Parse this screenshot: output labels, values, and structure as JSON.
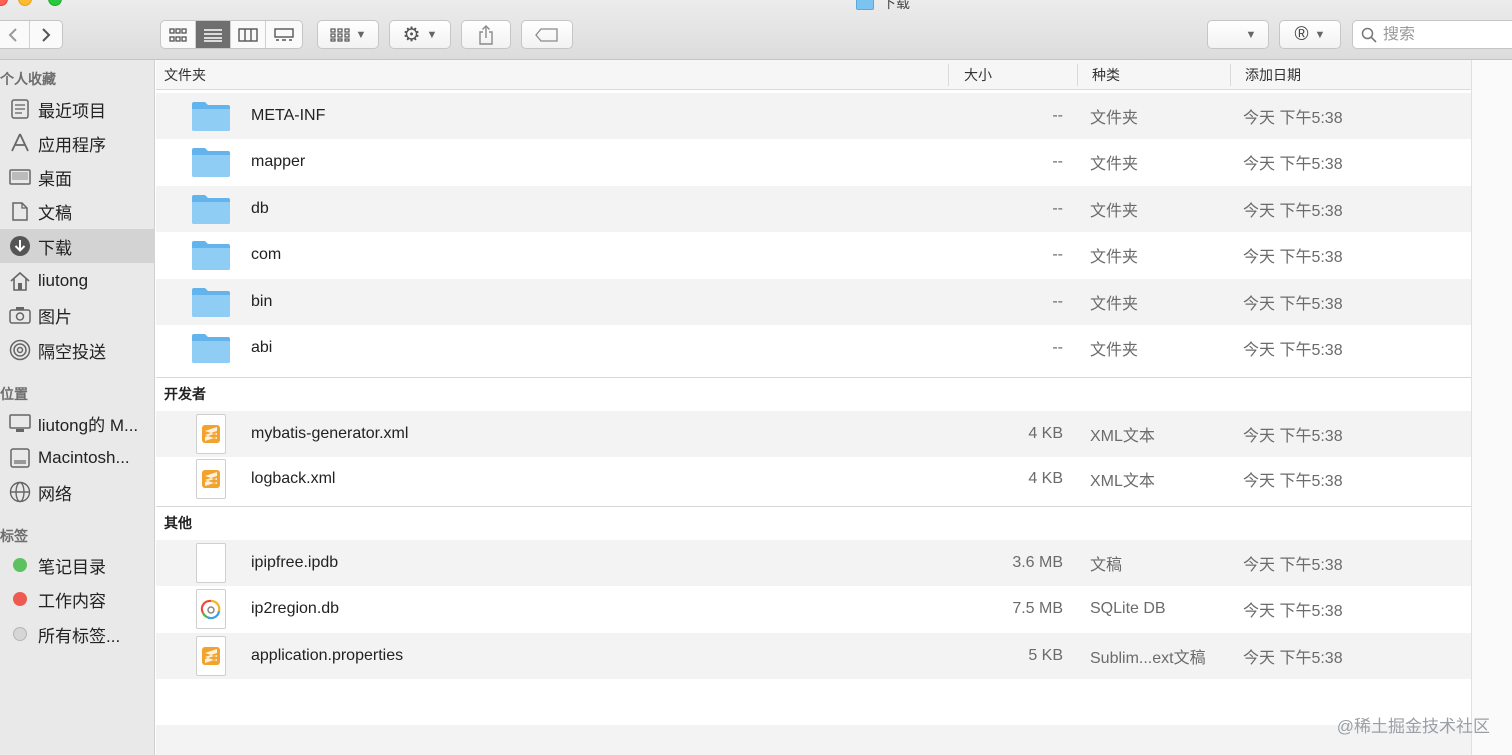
{
  "window": {
    "title": "下载"
  },
  "toolbar": {
    "search_placeholder": "搜索",
    "view_modes": [
      "icons",
      "list",
      "columns",
      "gallery"
    ],
    "active_view": "list"
  },
  "sidebar": {
    "favorites_header": "个人收藏",
    "favorites": [
      {
        "label": "最近项目",
        "icon": "recents-icon"
      },
      {
        "label": "应用程序",
        "icon": "applications-icon"
      },
      {
        "label": "桌面",
        "icon": "desktop-icon"
      },
      {
        "label": "文稿",
        "icon": "documents-icon"
      },
      {
        "label": "下载",
        "icon": "downloads-icon",
        "selected": true
      },
      {
        "label": "liutong",
        "icon": "home-icon"
      },
      {
        "label": "图片",
        "icon": "camera-icon"
      },
      {
        "label": "隔空投送",
        "icon": "airdrop-icon"
      }
    ],
    "locations_header": "位置",
    "locations": [
      {
        "label": "liutong的 M...",
        "icon": "computer-icon"
      },
      {
        "label": "Macintosh...",
        "icon": "disk-icon"
      },
      {
        "label": "网络",
        "icon": "network-icon"
      }
    ],
    "tags_header": "标签",
    "tags": [
      {
        "label": "笔记目录",
        "color": "#5cc160"
      },
      {
        "label": "工作内容",
        "color": "#ee5a52"
      },
      {
        "label": "所有标签...",
        "color": "#d6d6d6"
      }
    ]
  },
  "columns": {
    "name": "文件夹",
    "size": "大小",
    "kind": "种类",
    "date": "添加日期"
  },
  "groups": [
    {
      "header": "",
      "rows": [
        {
          "name": "META-INF",
          "size": "--",
          "kind": "文件夹",
          "date": "今天 下午5:38",
          "icon": "folder-icon"
        },
        {
          "name": "mapper",
          "size": "--",
          "kind": "文件夹",
          "date": "今天 下午5:38",
          "icon": "folder-icon"
        },
        {
          "name": "db",
          "size": "--",
          "kind": "文件夹",
          "date": "今天 下午5:38",
          "icon": "folder-icon"
        },
        {
          "name": "com",
          "size": "--",
          "kind": "文件夹",
          "date": "今天 下午5:38",
          "icon": "folder-icon"
        },
        {
          "name": "bin",
          "size": "--",
          "kind": "文件夹",
          "date": "今天 下午5:38",
          "icon": "folder-icon"
        },
        {
          "name": "abi",
          "size": "--",
          "kind": "文件夹",
          "date": "今天 下午5:38",
          "icon": "folder-icon"
        }
      ]
    },
    {
      "header": "开发者",
      "rows": [
        {
          "name": "mybatis-generator.xml",
          "size": "4 KB",
          "kind": "XML文本",
          "date": "今天 下午5:38",
          "icon": "sublime-file-icon"
        },
        {
          "name": "logback.xml",
          "size": "4 KB",
          "kind": "XML文本",
          "date": "今天 下午5:38",
          "icon": "sublime-file-icon"
        }
      ]
    },
    {
      "header": "其他",
      "rows": [
        {
          "name": "ipipfree.ipdb",
          "size": "3.6 MB",
          "kind": "文稿",
          "date": "今天 下午5:38",
          "icon": "blank-file-icon"
        },
        {
          "name": "ip2region.db",
          "size": "7.5 MB",
          "kind": "SQLite DB",
          "date": "今天 下午5:38",
          "icon": "sqlite-file-icon"
        },
        {
          "name": "application.properties",
          "size": "5 KB",
          "kind": "Sublim...ext文稿",
          "date": "今天 下午5:38",
          "icon": "sublime-file-icon"
        }
      ]
    }
  ],
  "watermark": "@稀土掘金技术社区"
}
